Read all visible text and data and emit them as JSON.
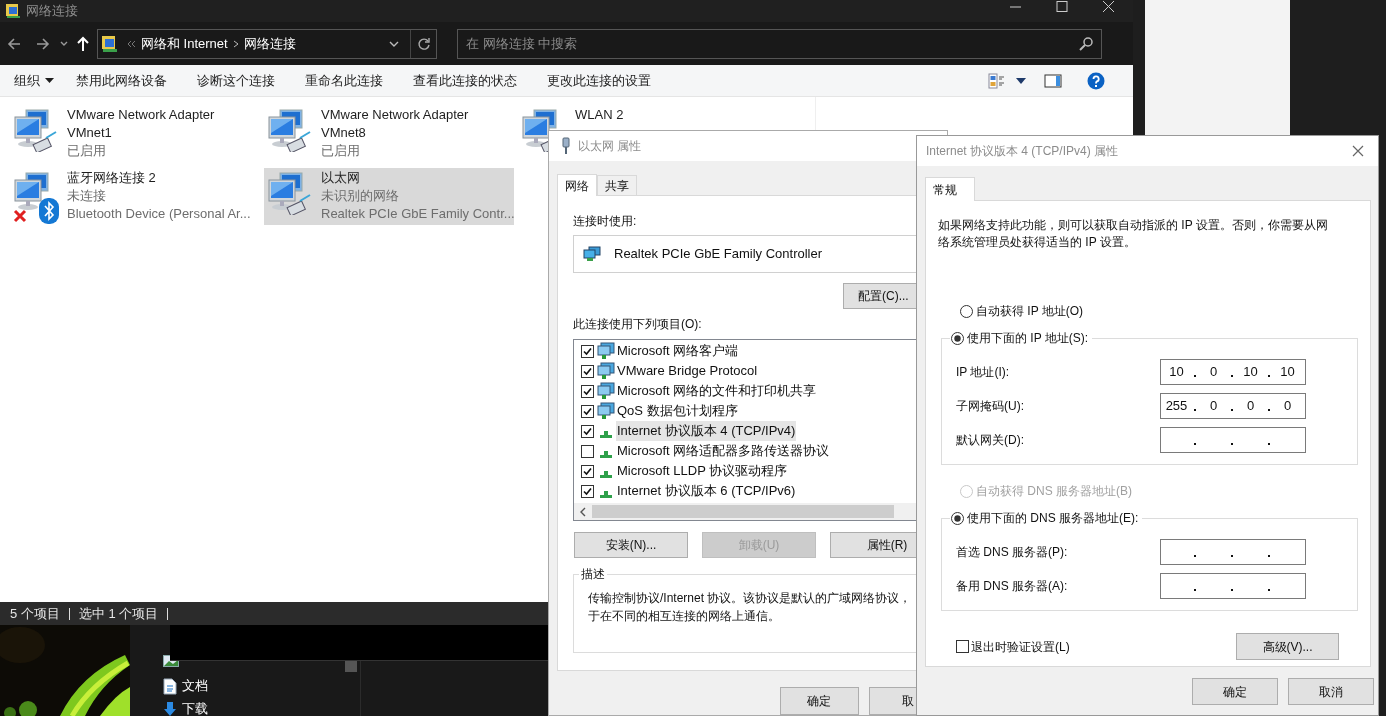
{
  "explorer": {
    "title": "网络连接",
    "breadcrumb": [
      "网络和 Internet",
      "网络连接"
    ],
    "search": {
      "placeholder": "在 网络连接 中搜索"
    },
    "organize_menu": {
      "label": "组织"
    },
    "commands": [
      "禁用此网络设备",
      "诊断这个连接",
      "重命名此连接",
      "查看此连接的状态",
      "更改此连接的设置"
    ],
    "items": [
      {
        "kind": "ethernet",
        "name": "VMware Network Adapter VMnet1",
        "status": "已启用",
        "selected": false
      },
      {
        "kind": "ethernet",
        "name": "VMware Network Adapter VMnet8",
        "status": "已启用",
        "selected": false
      },
      {
        "kind": "ethernet",
        "name": "WLAN 2",
        "selected": false
      },
      {
        "kind": "bluetooth",
        "name": "蓝牙网络连接 2",
        "status": "未连接",
        "device": "Bluetooth Device (Personal Ar...",
        "selected": false
      },
      {
        "kind": "ethernet",
        "name": "以太网",
        "status": "未识别的网络",
        "device": "Realtek PCIe GbE Family Contr...",
        "selected": true
      }
    ],
    "status_bar": [
      "5 个项目",
      "选中 1 个项目"
    ]
  },
  "navigation": [
    {
      "kind": "document",
      "label": "文档"
    },
    {
      "kind": "download",
      "label": "下载"
    }
  ],
  "ethernet_dialog": {
    "title": "以太网 属性",
    "tabs": [
      {
        "label": "网络",
        "selected": true
      },
      {
        "label": "共享",
        "selected": false
      }
    ],
    "connect_using_label": "连接时使用:",
    "adapter": "Realtek PCIe GbE Family Controller",
    "configure_button": "配置(C)...",
    "items_label": "此连接使用下列项目(O):",
    "components": [
      {
        "kind": "client",
        "label": "Microsoft 网络客户端",
        "checked": true,
        "selected": false
      },
      {
        "kind": "client",
        "label": "VMware Bridge Protocol",
        "checked": true,
        "selected": false
      },
      {
        "kind": "client",
        "label": "Microsoft 网络的文件和打印机共享",
        "checked": true,
        "selected": false
      },
      {
        "kind": "client",
        "label": "QoS 数据包计划程序",
        "checked": true,
        "selected": false
      },
      {
        "kind": "protocol",
        "label": "Internet 协议版本 4 (TCP/IPv4)",
        "checked": true,
        "selected": true
      },
      {
        "kind": "protocol",
        "label": "Microsoft 网络适配器多路传送器协议",
        "checked": false,
        "selected": false
      },
      {
        "kind": "protocol",
        "label": "Microsoft LLDP 协议驱动程序",
        "checked": true,
        "selected": false
      },
      {
        "kind": "protocol",
        "label": "Internet 协议版本 6 (TCP/IPv6)",
        "checked": true,
        "selected": false
      }
    ],
    "buttons": [
      {
        "label": "安装(N)...",
        "disabled": false
      },
      {
        "label": "卸载(U)",
        "disabled": true
      },
      {
        "label": "属性(R)",
        "disabled": false
      }
    ],
    "description": {
      "legend": "描述",
      "lines": [
        "传输控制协议/Internet 协议。该协议是默认的广域网络协议，",
        "于在不同的相互连接的网络上通信。"
      ]
    },
    "footer_buttons": [
      "确定",
      "取"
    ]
  },
  "ipv4_dialog": {
    "title": "Internet 协议版本 4 (TCP/IPv4) 属性",
    "tabs": [
      {
        "label": "常规",
        "selected": true
      }
    ],
    "intro": "如果网络支持此功能，则可以获取自动指派的 IP 设置。否则，你需要从网络系统管理员处获得适当的 IP 设置。",
    "ip_auto": {
      "label": "自动获得 IP 地址(O)",
      "selected": false,
      "disabled": false
    },
    "ip_manual": {
      "label": "使用下面的 IP 地址(S):",
      "selected": true,
      "disabled": false
    },
    "ip_fields": [
      {
        "label": "IP 地址(I):",
        "octets": [
          "10",
          "0",
          "10",
          "10"
        ]
      },
      {
        "label": "子网掩码(U):",
        "octets": [
          "255",
          "0",
          "0",
          "0"
        ]
      },
      {
        "label": "默认网关(D):"
      }
    ],
    "dns_auto": {
      "label": "自动获得 DNS 服务器地址(B)",
      "selected": false,
      "disabled": true
    },
    "dns_manual": {
      "label": "使用下面的 DNS 服务器地址(E):",
      "selected": true,
      "disabled": false
    },
    "dns_fields": [
      {
        "label": "首选 DNS 服务器(P):"
      },
      {
        "label": "备用 DNS 服务器(A):"
      }
    ],
    "validate": {
      "label": "退出时验证设置(L)",
      "checked": false
    },
    "advanced_button": "高级(V)...",
    "footer_buttons": [
      "确定",
      "取消"
    ]
  }
}
